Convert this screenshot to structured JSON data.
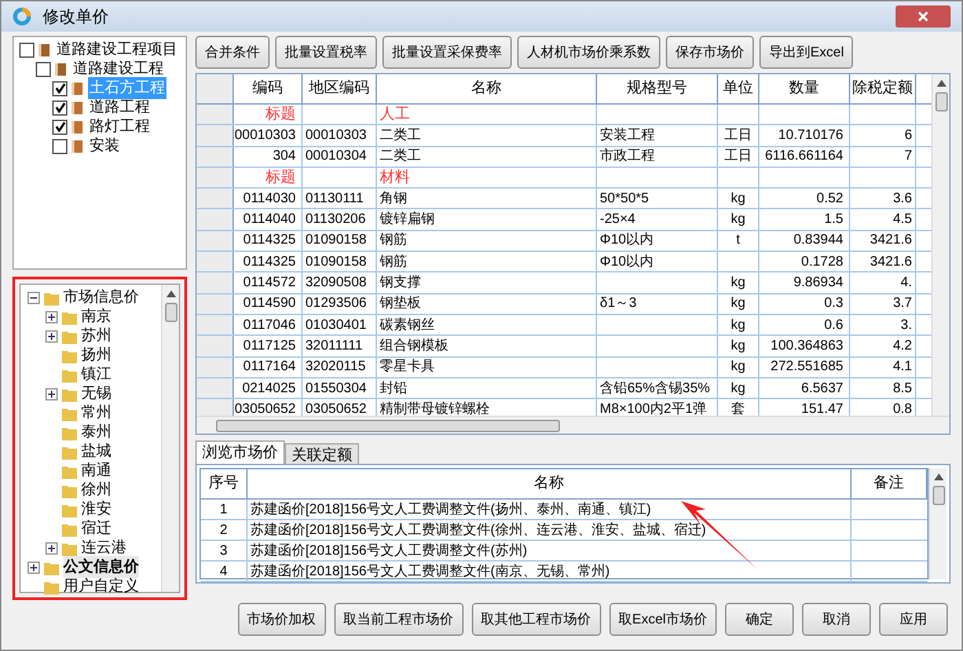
{
  "window": {
    "title": "修改单价"
  },
  "project_tree": [
    {
      "label": "道路建设工程项目",
      "checked": false,
      "selected": false,
      "children": [
        {
          "label": "道路建设工程",
          "checked": false,
          "selected": false,
          "children": [
            {
              "label": "土石方工程",
              "checked": true,
              "selected": true
            },
            {
              "label": "道路工程",
              "checked": true,
              "selected": false
            },
            {
              "label": "路灯工程",
              "checked": true,
              "selected": false
            },
            {
              "label": "安装",
              "checked": false,
              "selected": false
            }
          ]
        }
      ]
    }
  ],
  "price_tree": [
    {
      "label": "市场信息价",
      "kind": "expanded",
      "selected": false,
      "children": [
        {
          "label": "南京",
          "kind": "collapsed",
          "selected": false
        },
        {
          "label": "苏州",
          "kind": "collapsed",
          "selected": false
        },
        {
          "label": "扬州",
          "kind": "leaf",
          "selected": false
        },
        {
          "label": "镇江",
          "kind": "leaf",
          "selected": false
        },
        {
          "label": "无锡",
          "kind": "collapsed",
          "selected": false
        },
        {
          "label": "常州",
          "kind": "leaf",
          "selected": false
        },
        {
          "label": "泰州",
          "kind": "leaf",
          "selected": false
        },
        {
          "label": "盐城",
          "kind": "leaf",
          "selected": false
        },
        {
          "label": "南通",
          "kind": "leaf",
          "selected": false
        },
        {
          "label": "徐州",
          "kind": "leaf",
          "selected": false
        },
        {
          "label": "淮安",
          "kind": "leaf",
          "selected": false
        },
        {
          "label": "宿迁",
          "kind": "leaf",
          "selected": false
        },
        {
          "label": "连云港",
          "kind": "collapsed",
          "selected": false
        }
      ]
    },
    {
      "label": "公文信息价",
      "kind": "collapsed",
      "selected": true
    },
    {
      "label": "用户自定义",
      "kind": "leaf",
      "selected": false
    }
  ],
  "toolbar": [
    "合并条件",
    "批量设置税率",
    "批量设置采保费率",
    "人材机市场价乘系数",
    "保存市场价",
    "导出到Excel"
  ],
  "table": {
    "columns": [
      "编码",
      "地区编码",
      "名称",
      "规格型号",
      "单位",
      "数量",
      "除税定额"
    ],
    "rows": [
      {
        "kind": "heading",
        "code": "标题",
        "name": "人工"
      },
      {
        "kind": "item",
        "code": "00010303",
        "region_code": "00010303",
        "name": "二类工",
        "spec": "安装工程",
        "unit": "工日",
        "qty": "10.710176",
        "column_7": "6"
      },
      {
        "kind": "item",
        "code": "304",
        "region_code": "00010304",
        "name": "二类工",
        "spec": "市政工程",
        "unit": "工日",
        "qty": "6116.661164",
        "column_7": "7"
      },
      {
        "kind": "heading",
        "code": "标题",
        "name": "材料"
      },
      {
        "kind": "item",
        "code": "0114030",
        "region_code": "01130111",
        "name": "角钢",
        "spec": "50*50*5",
        "unit": "kg",
        "qty": "0.52",
        "column_7": "3.6"
      },
      {
        "kind": "item",
        "code": "0114040",
        "region_code": "01130206",
        "name": "镀锌扁钢",
        "spec": "-25×4",
        "unit": "kg",
        "qty": "1.5",
        "column_7": "4.5"
      },
      {
        "kind": "item",
        "code": "0114325",
        "region_code": "01090158",
        "name": "钢筋",
        "spec": "Φ10以内",
        "unit": "t",
        "qty": "0.83944",
        "column_7": "3421.6"
      },
      {
        "kind": "item",
        "code": "0114325",
        "region_code": "01090158",
        "name": "钢筋",
        "spec": "Φ10以内",
        "qty": "0.1728",
        "column_7": "3421.6"
      },
      {
        "kind": "item",
        "code": "0114572",
        "region_code": "32090508",
        "name": "钢支撑",
        "unit": "kg",
        "qty": "9.86934",
        "column_7": "4."
      },
      {
        "kind": "item",
        "code": "0114590",
        "region_code": "01293506",
        "name": "钢垫板",
        "spec": "δ1～3",
        "unit": "kg",
        "qty": "0.3",
        "column_7": "3.7"
      },
      {
        "kind": "item",
        "code": "0117046",
        "region_code": "01030401",
        "name": "碳素钢丝",
        "unit": "kg",
        "qty": "0.6",
        "column_7": "3."
      },
      {
        "kind": "item",
        "code": "0117125",
        "region_code": "32011111",
        "name": "组合钢模板",
        "unit": "kg",
        "qty": "100.364863",
        "column_7": "4.2"
      },
      {
        "kind": "item",
        "code": "0117164",
        "region_code": "32020115",
        "name": "零星卡具",
        "unit": "kg",
        "qty": "272.551685",
        "column_7": "4.1"
      },
      {
        "kind": "item",
        "code": "0214025",
        "region_code": "01550304",
        "name": "封铅",
        "spec": "含铅65%含锡35%",
        "unit": "kg",
        "qty": "6.5637",
        "column_7": "8.5"
      },
      {
        "kind": "item",
        "code": "03050652",
        "region_code": "03050652",
        "name": "精制带母镀锌螺栓",
        "spec": "M8×100内2平1弹",
        "unit": "套",
        "qty": "151.47",
        "column_7": "0.8"
      }
    ]
  },
  "tabs": [
    {
      "label": "浏览市场价",
      "selected": true
    },
    {
      "label": "关联定额",
      "selected": false
    }
  ],
  "price_files": {
    "columns": [
      "序号",
      "名称",
      "备注"
    ],
    "rows": [
      {
        "no": "1",
        "name": "苏建函价[2018]156号文人工费调整文件(扬州、泰州、南通、镇江)"
      },
      {
        "no": "2",
        "name": "苏建函价[2018]156号文人工费调整文件(徐州、连云港、淮安、盐城、宿迁)"
      },
      {
        "no": "3",
        "name": "苏建函价[2018]156号文人工费调整文件(苏州)"
      },
      {
        "no": "4",
        "name": "苏建函价[2018]156号文人工费调整文件(南京、无锡、常州)"
      }
    ]
  },
  "buttons": [
    "市场价加权",
    "取当前工程市场价",
    "取其他工程市场价",
    "取Excel市场价",
    "确定",
    "取消",
    "应用"
  ]
}
